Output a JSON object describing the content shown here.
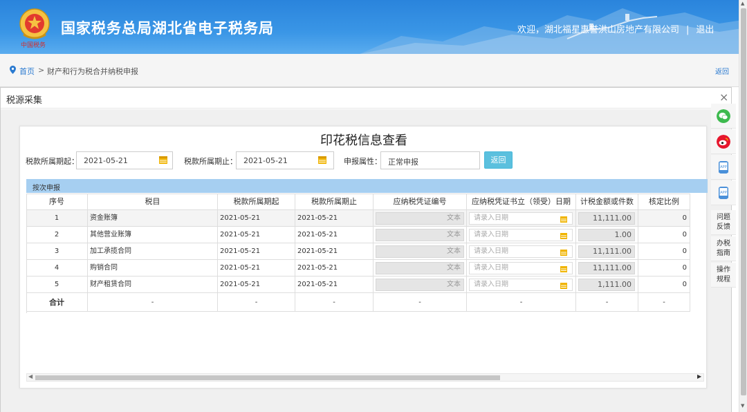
{
  "header": {
    "site_title": "国家税务总局湖北省电子税务局",
    "emblem_script": "中国税务",
    "welcome": "欢迎，湖北福星惠誉洪山房地产有限公司",
    "separator": "|",
    "logout": "退出"
  },
  "breadcrumb": {
    "home": "首页",
    "arrow": ">",
    "current": "财产和行为税合并纳税申报",
    "back": "返回"
  },
  "dialog": {
    "title": "税源采集",
    "close": "×"
  },
  "panel": {
    "title": "印花税信息查看",
    "form": {
      "start_label": "税款所属期起：",
      "start_value": "2021-05-21",
      "end_label": "税款所属期止：",
      "end_value": "2021-05-21",
      "attr_label": "申报属性：",
      "attr_value": "正常申报",
      "back_button": "返回"
    },
    "section_label": "按次申报",
    "table": {
      "headers": [
        "序号",
        "税目",
        "税款所属期起",
        "税款所属期止",
        "应纳税凭证编号",
        "应纳税凭证书立（领受）日期",
        "计税金额或件数",
        "核定比例"
      ],
      "rows": [
        {
          "no": "1",
          "item": "资金账簿",
          "start": "2021-05-21",
          "end": "2021-05-21",
          "voucher": "文本",
          "date": "请录入日期",
          "amount": "11,111.00",
          "ratio": "0"
        },
        {
          "no": "2",
          "item": "其他营业账簿",
          "start": "2021-05-21",
          "end": "2021-05-21",
          "voucher": "文本",
          "date": "请录入日期",
          "amount": "1.00",
          "ratio": "0"
        },
        {
          "no": "3",
          "item": "加工承揽合同",
          "start": "2021-05-21",
          "end": "2021-05-21",
          "voucher": "文本",
          "date": "请录入日期",
          "amount": "11,111.00",
          "ratio": "0"
        },
        {
          "no": "4",
          "item": "购销合同",
          "start": "2021-05-21",
          "end": "2021-05-21",
          "voucher": "文本",
          "date": "请录入日期",
          "amount": "11,111.00",
          "ratio": "0"
        },
        {
          "no": "5",
          "item": "财产租赁合同",
          "start": "2021-05-21",
          "end": "2021-05-21",
          "voucher": "文本",
          "date": "请录入日期",
          "amount": "1,111.00",
          "ratio": "0"
        }
      ],
      "total": {
        "label": "合计",
        "dash": "-"
      }
    }
  },
  "sidetool": {
    "items": [
      {
        "icon": "wechat-icon",
        "color": "#3dba4e"
      },
      {
        "icon": "weibo-icon",
        "color": "#e6162d"
      },
      {
        "icon": "app-icon",
        "label": "APP"
      },
      {
        "icon": "app-icon",
        "label": "APP"
      }
    ],
    "feedback": [
      "问题",
      "反馈"
    ],
    "guide": [
      "办税",
      "指南"
    ],
    "manual": [
      "操作",
      "规程"
    ]
  },
  "colors": {
    "header": "#2a84dc",
    "section_bar": "#a6cff1",
    "back_button": "#5bc0de",
    "calendar_icon": "#f0b400",
    "link": "#2a7ad0"
  }
}
